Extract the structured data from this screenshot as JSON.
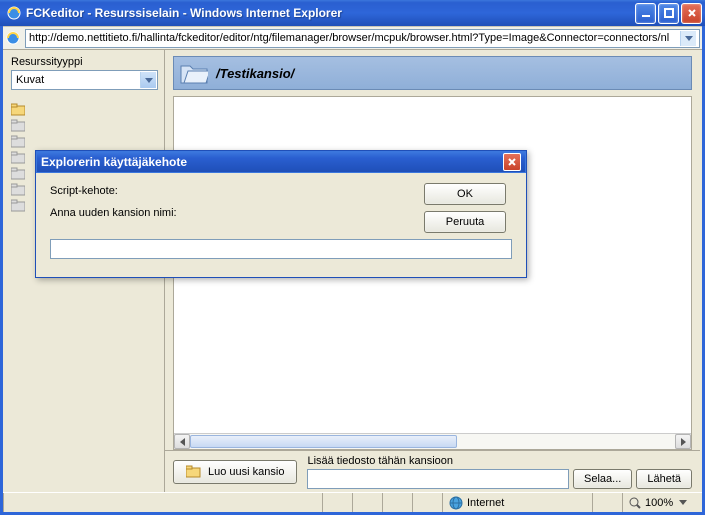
{
  "window": {
    "title": "FCKeditor - Resurssiselain - Windows Internet Explorer"
  },
  "address": {
    "url": "http://demo.nettitieto.fi/hallinta/fckeditor/editor/ntg/filemanager/browser/mcpuk/browser.html?Type=Image&Connector=connectors/nl"
  },
  "sidebar": {
    "label": "Resurssityyppi",
    "select_value": "Kuvat"
  },
  "breadcrumb": {
    "path": "/Testikansio/"
  },
  "bottom": {
    "new_folder": "Luo uusi kansio",
    "upload_label": "Lisää tiedosto tähän kansioon",
    "browse": "Selaa...",
    "send": "Lähetä"
  },
  "status": {
    "zone": "Internet",
    "zoom": "100%"
  },
  "dialog": {
    "title": "Explorerin käyttäjäkehote",
    "line1": "Script-kehote:",
    "line2": "Anna uuden kansion nimi:",
    "ok": "OK",
    "cancel": "Peruuta",
    "value": ""
  }
}
